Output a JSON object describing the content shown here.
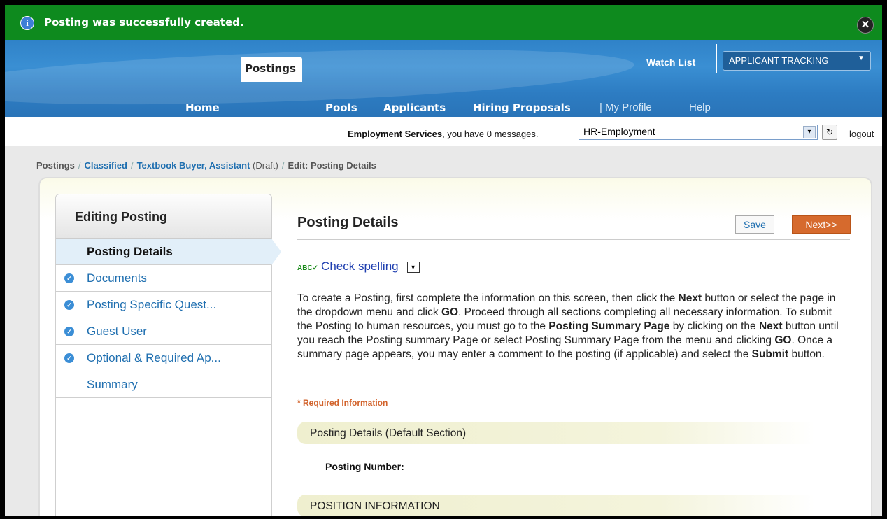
{
  "notification": {
    "message": "Posting was successfully created."
  },
  "header": {
    "watch_list": "Watch List",
    "app_selector": "APPLICANT TRACKING",
    "nav": [
      {
        "label": "Home"
      },
      {
        "label": "Postings"
      },
      {
        "label": "Pools"
      },
      {
        "label": "Applicants"
      },
      {
        "label": "Hiring Proposals"
      },
      {
        "label": "| My Profile"
      },
      {
        "label": "Help"
      }
    ]
  },
  "userbar": {
    "user_name": "Employment Services",
    "messages_text": ", you have 0 messages.",
    "department": "HR-Employment",
    "logout": "logout"
  },
  "breadcrumb": {
    "root": "Postings",
    "level1": "Classified",
    "level2": "Textbook Buyer, Assistant",
    "status": "(Draft)",
    "current": "Edit: Posting Details"
  },
  "sidebar": {
    "title": "Editing Posting",
    "items": [
      {
        "label": "Posting Details"
      },
      {
        "label": "Documents"
      },
      {
        "label": "Posting Specific Quest..."
      },
      {
        "label": "Guest User"
      },
      {
        "label": "Optional & Required Ap..."
      },
      {
        "label": "Summary"
      }
    ]
  },
  "main": {
    "title": "Posting Details",
    "save_label": "Save",
    "next_label": "Next>>",
    "spellcheck_label": "Check spelling",
    "instructions": [
      "To create a Posting, first complete the information on this screen, then click the ",
      "Next",
      " button or select the page in the dropdown menu and click ",
      "GO",
      ". Proceed through all sections completing all necessary information. To submit the Posting to human resources, you must go to the ",
      "Posting Summary Page",
      " by clicking on the ",
      "Next",
      " button until you reach the Posting summary Page or select Posting Summary Page from the menu and clicking ",
      "GO",
      ". Once a summary page appears, you may enter a comment to the posting (if applicable) and select the ",
      "Submit",
      " button."
    ],
    "required_note": "* Required Information",
    "section1": "Posting Details (Default Section)",
    "field_posting_number": "Posting Number:",
    "section2": "POSITION INFORMATION"
  }
}
